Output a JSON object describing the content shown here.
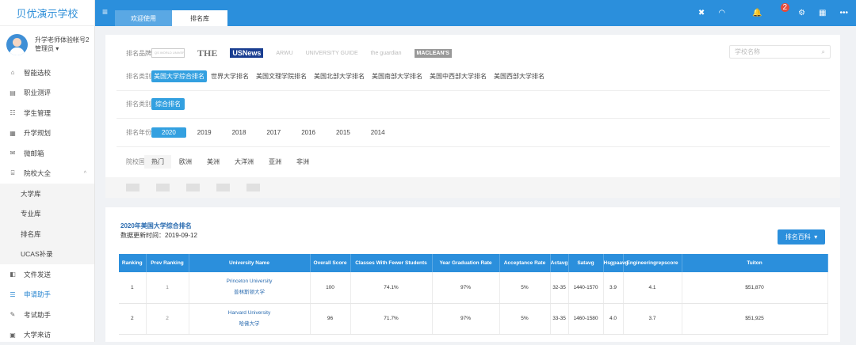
{
  "sidebar": {
    "brand": "贝优演示学校",
    "user_name": "升学老师体验帐号2",
    "user_role": "管理员 ▾",
    "items": [
      {
        "icon": "⌂",
        "label": "智能选校"
      },
      {
        "icon": "▤",
        "label": "职业测评"
      },
      {
        "icon": "☷",
        "label": "学生管理"
      },
      {
        "icon": "▦",
        "label": "升学规划"
      },
      {
        "icon": "✉",
        "label": "微邮箱"
      },
      {
        "icon": "⌸",
        "label": "院校大全",
        "caret": "^"
      }
    ],
    "subitems": [
      "大学库",
      "专业库",
      "排名库",
      "UCAS补录"
    ],
    "items2": [
      {
        "icon": "◧",
        "label": "文件发送"
      },
      {
        "icon": "☰",
        "label": "申请助手"
      },
      {
        "icon": "✎",
        "label": "考试助手"
      },
      {
        "icon": "▣",
        "label": "大学来访"
      }
    ]
  },
  "topbar": {
    "menu_icon": "≡",
    "tabs": [
      "欢迎使用",
      "排名库"
    ],
    "icons": [
      "✖",
      "◠",
      "🔔",
      "⚙",
      "▦",
      "•••"
    ],
    "badge": "2"
  },
  "filters": {
    "brand_label": "排名品牌",
    "brands": [
      "QS WORLD UNIVERSITY RANKINGS",
      "THE",
      "USNews",
      "ARWU",
      "UNIVERSITY GUIDE",
      "the guardian",
      "MACLEAN'S"
    ],
    "search_placeholder": "学校名称",
    "category_label": "排名类别",
    "categories": [
      "美国大学综合排名",
      "世界大学排名",
      "美国文理学院排名",
      "美国北部大学排名",
      "美国南部大学排名",
      "美国中西部大学排名",
      "美国西部大学排名"
    ],
    "category2_label": "排名类别",
    "category2_selected": "综合排名",
    "year_label": "排名年份",
    "years": [
      "2020",
      "2019",
      "2018",
      "2017",
      "2016",
      "2015",
      "2014"
    ],
    "country_label": "院校国家",
    "countries": [
      "热门",
      "欧洲",
      "美洲",
      "大洋洲",
      "亚洲",
      "非洲"
    ]
  },
  "ranking": {
    "title": "2020年美国大学综合排名",
    "updated": "数据更新时间：2019-09-12",
    "wiki_button": "排名百科",
    "columns": [
      "Ranking",
      "Prev Ranking",
      "University Name",
      "Overall Score",
      "Classes With Fewer Students",
      "Year Graduation Rate",
      "Acceptance Rate",
      "Actavg",
      "Satavg",
      "Hsgpaavg",
      "Engineeringrepscore",
      "Tuiton"
    ],
    "rows": [
      {
        "rank": "1",
        "prev": "1",
        "name_en": "Princeton University",
        "name_cn": "普林斯顿大学",
        "score": "100",
        "classes": "74.1%",
        "grad": "97%",
        "accept": "5%",
        "act": "32-35",
        "sat": "1440-1570",
        "gpa": "3.9",
        "eng": "4.1",
        "tuition": "$51,870"
      },
      {
        "rank": "2",
        "prev": "2",
        "name_en": "Harvard University",
        "name_cn": "哈佛大学",
        "score": "96",
        "classes": "71.7%",
        "grad": "97%",
        "accept": "5%",
        "act": "33-35",
        "sat": "1460-1580",
        "gpa": "4.0",
        "eng": "3.7",
        "tuition": "$51,925"
      }
    ]
  }
}
